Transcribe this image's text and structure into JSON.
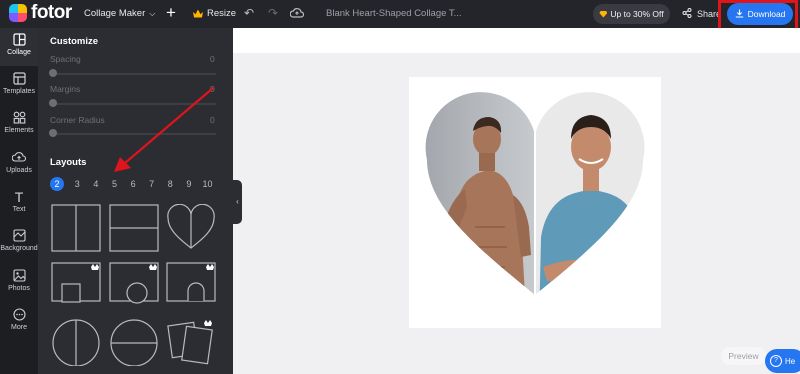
{
  "app": {
    "brand": "fotor"
  },
  "topbar": {
    "mode_label": "Collage Maker",
    "resize_label": "Resize",
    "doc_title": "Blank Heart-Shaped Collage T...",
    "promo_label": "Up to 30% Off",
    "share_label": "Share",
    "download_label": "Download"
  },
  "rail": [
    {
      "label": "Collage",
      "icon": "collage-icon"
    },
    {
      "label": "Templates",
      "icon": "templates-icon"
    },
    {
      "label": "Elements",
      "icon": "elements-icon"
    },
    {
      "label": "Uploads",
      "icon": "uploads-icon"
    },
    {
      "label": "Text",
      "icon": "text-icon"
    },
    {
      "label": "Background",
      "icon": "background-icon"
    },
    {
      "label": "Photos",
      "icon": "photos-icon"
    },
    {
      "label": "More",
      "icon": "more-icon"
    }
  ],
  "panel": {
    "customize_title": "Customize",
    "sliders": [
      {
        "label": "Spacing",
        "value": "0"
      },
      {
        "label": "Margins",
        "value": "0"
      },
      {
        "label": "Corner Radius",
        "value": "0"
      }
    ],
    "layouts_title": "Layouts",
    "layout_counts": [
      "2",
      "3",
      "4",
      "5",
      "6",
      "7",
      "8",
      "9",
      "10"
    ],
    "selected_count": "2"
  },
  "bottom": {
    "preview_label": "Preview",
    "help_label": "He"
  },
  "colors": {
    "accent": "#2576f0",
    "highlight": "#e0141b",
    "annotation_arrow": "#e0141b"
  }
}
